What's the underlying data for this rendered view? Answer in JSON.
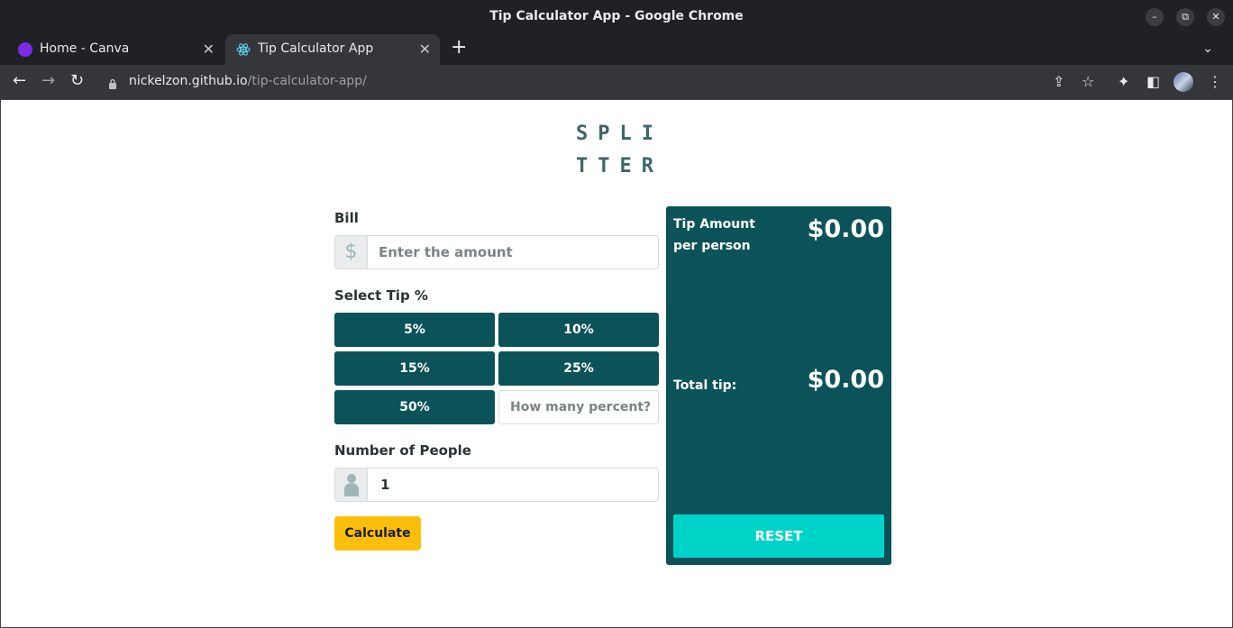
{
  "window": {
    "title": "Tip Calculator App - Google Chrome",
    "minimize_label": "–",
    "restore_label": "⧉",
    "close_label": "✕"
  },
  "tabs": [
    {
      "label": "Home - Canva",
      "close": "✕",
      "favicon_color": "#7d2ae8"
    },
    {
      "label": "Tip Calculator App",
      "close": "✕",
      "favicon_color": "#61dafb"
    }
  ],
  "tabstrip": {
    "new_tab": "+",
    "tab_search": "⌄"
  },
  "toolbar": {
    "back": "←",
    "forward": "→",
    "reload": "↻",
    "url_host": "nickelzon.github.io",
    "url_path": "/tip-calculator-app/",
    "share": "⇪",
    "bookmark": "☆",
    "extensions": "✦",
    "side_panel": "◧",
    "menu": "⋮"
  },
  "app": {
    "logo_line1": "SPLI",
    "logo_line2": "TTER",
    "bill_label": "Bill",
    "bill_placeholder": "Enter the amount",
    "bill_prefix": "$",
    "tip_label": "Select Tip %",
    "tip_options": [
      "5%",
      "10%",
      "15%",
      "25%",
      "50%"
    ],
    "custom_tip_placeholder": "How many percent?",
    "people_label": "Number of People",
    "people_value": "1",
    "calculate_label": "Calculate",
    "tip_amount_label_1": "Tip Amount",
    "tip_amount_label_2": "per person",
    "tip_amount_value": "$0.00",
    "total_tip_label": "Total tip:",
    "total_tip_value": "$0.00",
    "reset_label": "RESET"
  },
  "colors": {
    "primary": "#0b5358",
    "accent": "#00d4c8",
    "calculate": "#fbbf0b",
    "logo": "#3d6666"
  }
}
